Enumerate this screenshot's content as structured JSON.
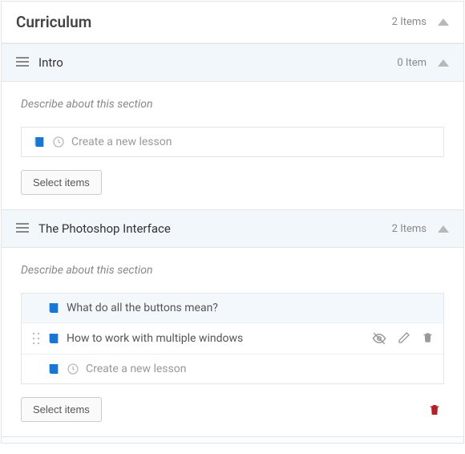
{
  "header": {
    "title": "Curriculum",
    "count": "2 Items"
  },
  "sections": [
    {
      "title": "Intro",
      "count": "0 Item",
      "describe": "Describe about this section",
      "items": [],
      "new_lesson_placeholder": "Create a new lesson",
      "select_button": "Select items",
      "show_delete": false
    },
    {
      "title": "The Photoshop Interface",
      "count": "2 Items",
      "describe": "Describe about this section",
      "items": [
        {
          "title": "What do all the buttons mean?",
          "selected": true,
          "show_actions": false,
          "show_drag": false
        },
        {
          "title": "How to work with multiple windows",
          "selected": false,
          "show_actions": true,
          "show_drag": true
        }
      ],
      "new_lesson_placeholder": "Create a new lesson",
      "select_button": "Select items",
      "show_delete": true
    }
  ]
}
